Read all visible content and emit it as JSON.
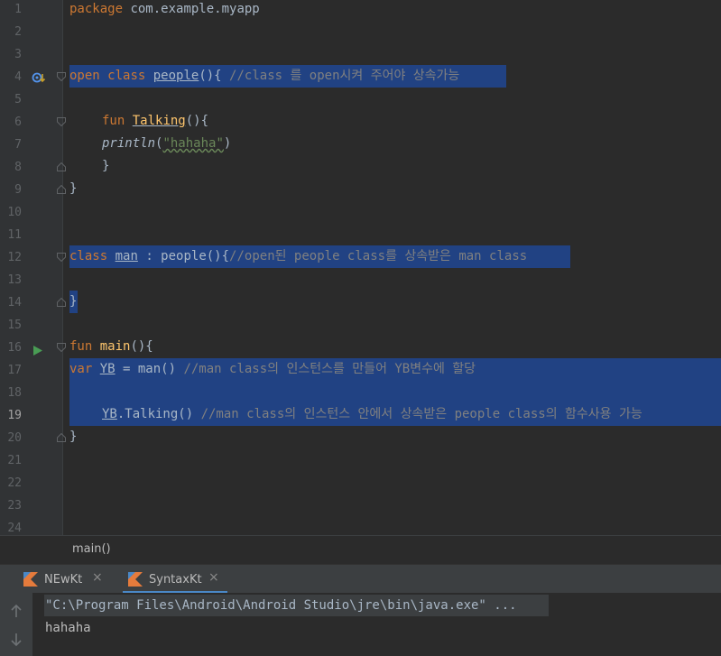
{
  "editor": {
    "line_numbers": [
      "1",
      "2",
      "3",
      "4",
      "5",
      "6",
      "7",
      "8",
      "9",
      "10",
      "11",
      "12",
      "13",
      "14",
      "15",
      "16",
      "17",
      "18",
      "19",
      "20",
      "21",
      "22",
      "23",
      "24"
    ],
    "line1": {
      "kw": "package",
      "rest": " com.example.myapp"
    },
    "line4": {
      "open": "open",
      "class": "class",
      "name": "people",
      "tail": "(){ ",
      "comment": "//class 를 open시켜 주어야 상속가능"
    },
    "line6": {
      "kw": "fun",
      "name": "Talking",
      "tail": "(){"
    },
    "line7": {
      "fn": "println",
      "open": "(",
      "str": "\"hahaha\"",
      "close": ")"
    },
    "line8": {
      "text": "}"
    },
    "line9": {
      "text": "}"
    },
    "line12": {
      "class": "class",
      "name": "man",
      "mid": " : people(){",
      "comment": "//open된 people class를 상속받은 man class"
    },
    "line14": {
      "text": "}"
    },
    "line16": {
      "kw": "fun",
      "name": "main",
      "tail": "(){"
    },
    "line17": {
      "kw": "var",
      "var": "YB",
      "mid": " = man() ",
      "comment": "//man class의 인스턴스를 만들어 YB변수에 할당"
    },
    "line19": {
      "var": "YB",
      "mid": ".Talking() ",
      "comment": "//man class의 인스턴스 안에서 상속받은 people class의 함수사용 가능"
    },
    "line20": {
      "text": "}"
    }
  },
  "breadcrumb": {
    "label": "main()"
  },
  "run_tabs": [
    {
      "label": "NEwKt",
      "close": "×"
    },
    {
      "label": "SyntaxKt",
      "close": "×"
    }
  ],
  "console": {
    "command": "\"C:\\Program Files\\Android\\Android Studio\\jre\\bin\\java.exe\" ...",
    "output": "hahaha"
  },
  "colors": {
    "background": "#2b2b2b",
    "selection": "#214283",
    "keyword": "#cc7832",
    "comment": "#808080",
    "function": "#ffc66d",
    "string": "#6a8759",
    "tab_accent": "#4a88c7",
    "run_icon": "#499c54"
  }
}
